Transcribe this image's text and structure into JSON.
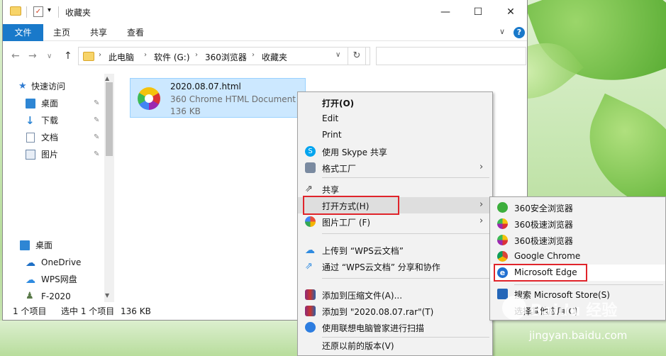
{
  "window": {
    "title": "收藏夹",
    "minimize": "—",
    "maximize": "☐",
    "close": "✕"
  },
  "ribbon": {
    "tabs": [
      "文件",
      "主页",
      "共享",
      "查看"
    ],
    "expand": "∨",
    "help": "?"
  },
  "address": {
    "back": "←",
    "forward": "→",
    "recent": "∨",
    "up": "↑",
    "crumbs": [
      "此电脑",
      "软件 (G:)",
      "360浏览器",
      "收藏夹"
    ],
    "separator": "›",
    "dropdown": "∨",
    "refresh": "↻",
    "search_value": ""
  },
  "navpane": {
    "items": [
      {
        "label": "快速访问",
        "icon": "star-icon",
        "pinned": false
      },
      {
        "label": "桌面",
        "icon": "desktop-icon",
        "pinned": true
      },
      {
        "label": "下载",
        "icon": "download-icon",
        "pinned": true
      },
      {
        "label": "文档",
        "icon": "document-icon",
        "pinned": true
      },
      {
        "label": "图片",
        "icon": "picture-icon",
        "pinned": true
      },
      {
        "label": "桌面",
        "icon": "desktop-icon",
        "pinned": false
      },
      {
        "label": "OneDrive",
        "icon": "cloud-icon",
        "pinned": false
      },
      {
        "label": "WPS网盘",
        "icon": "cloud-icon",
        "pinned": false
      },
      {
        "label": "F-2020",
        "icon": "user-icon",
        "pinned": false
      }
    ],
    "pin_glyph": "📌"
  },
  "file": {
    "name": "2020.08.07.html",
    "type": "360 Chrome HTML Document",
    "size": "136 KB"
  },
  "status": {
    "count": "1 个项目",
    "selected": "选中 1 个项目",
    "size": "136 KB"
  },
  "context_menu": {
    "items": [
      {
        "label": "打开(O)",
        "bold": true
      },
      {
        "label": "Edit"
      },
      {
        "label": "Print"
      },
      {
        "label": "使用 Skype 共享"
      },
      {
        "label": "格式工厂",
        "arrow": "›"
      },
      {
        "label": "共享"
      },
      {
        "label": "打开方式(H)",
        "arrow": "›"
      },
      {
        "label": "图片工厂 (F)",
        "arrow": "›"
      },
      {
        "label": "上传到 “WPS云文档”"
      },
      {
        "label": "通过 “WPS云文档” 分享和协作"
      },
      {
        "label": "添加到压缩文件(A)..."
      },
      {
        "label": "添加到 \"2020.08.07.rar\"(T)"
      },
      {
        "label": "使用联想电脑管家进行扫描"
      },
      {
        "label": "还原以前的版本(V)"
      }
    ]
  },
  "submenu": {
    "items": [
      {
        "label": "360安全浏览器"
      },
      {
        "label": "360极速浏览器"
      },
      {
        "label": "360极速浏览器"
      },
      {
        "label": "Google Chrome"
      },
      {
        "label": "Microsoft Edge"
      },
      {
        "label": "搜索 Microsoft Store(S)"
      },
      {
        "label": "选择其他应用(C)"
      }
    ]
  },
  "watermark": {
    "text": "Baidu 经验",
    "url": "jingyan.baidu.com"
  },
  "colors": {
    "accent": "#1979ca",
    "selection": "#cce8ff",
    "highlight_box": "#e0242b"
  }
}
